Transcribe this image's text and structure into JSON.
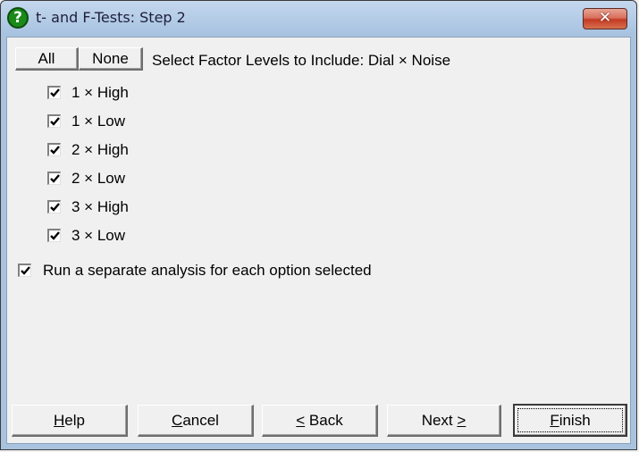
{
  "window": {
    "title": "t- and F-Tests: Step 2",
    "title_icon": "help-question-icon",
    "close_icon": "close-icon",
    "close_glyph": "✕"
  },
  "toolbar": {
    "all_label": "All",
    "none_label": "None",
    "instruction": "Select Factor Levels to Include: Dial × Noise"
  },
  "factor_levels": [
    {
      "label": "1 × High",
      "checked": true
    },
    {
      "label": "1 × Low",
      "checked": true
    },
    {
      "label": "2 × High",
      "checked": true
    },
    {
      "label": "2 × Low",
      "checked": true
    },
    {
      "label": "3 × High",
      "checked": true
    },
    {
      "label": "3 × Low",
      "checked": true
    }
  ],
  "separate_analysis": {
    "label": "Run a separate analysis for each option selected",
    "checked": true
  },
  "buttons": {
    "help": {
      "mnemonic": "H",
      "rest": "elp"
    },
    "cancel": {
      "mnemonic": "C",
      "rest": "ancel"
    },
    "back": {
      "mnemonic": "<",
      "rest": " Back"
    },
    "next": {
      "pre": "Next ",
      "mnemonic": ">"
    },
    "finish": {
      "mnemonic": "F",
      "rest": "inish"
    }
  }
}
